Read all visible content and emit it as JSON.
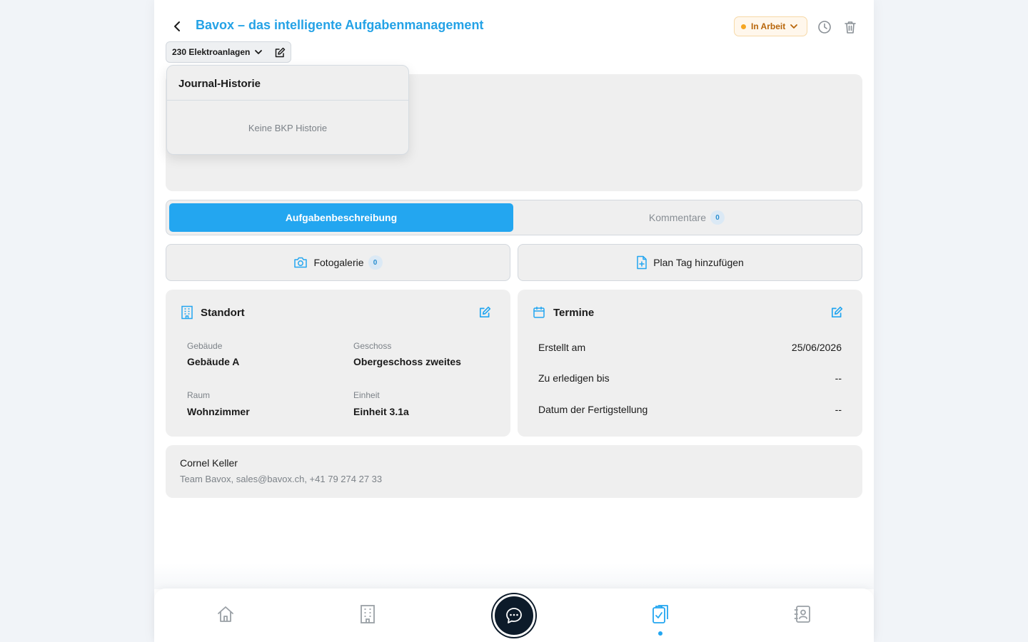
{
  "header": {
    "title": "Bavox – das intelligente Aufgabenmanagement",
    "status": {
      "label": "In Arbeit",
      "dot_color": "#f5a623"
    },
    "bkp": {
      "label": "230 Elektroanlagen"
    }
  },
  "journal_popover": {
    "title": "Journal-Historie",
    "empty_text": "Keine BKP Historie"
  },
  "tabs": [
    {
      "label": "Aufgabenbeschreibung",
      "active": true
    },
    {
      "label": "Kommentare",
      "count": "0",
      "active": false
    }
  ],
  "actions": {
    "gallery": {
      "label": "Fotogalerie",
      "count": "0"
    },
    "plan_tag": {
      "label": "Plan Tag hinzufügen"
    }
  },
  "location": {
    "title": "Standort",
    "fields": [
      {
        "label": "Gebäude",
        "value": "Gebäude A"
      },
      {
        "label": "Geschoss",
        "value": "Obergeschoss zweites"
      },
      {
        "label": "Raum",
        "value": "Wohnzimmer"
      },
      {
        "label": "Einheit",
        "value": "Einheit 3.1a"
      }
    ]
  },
  "dates": {
    "title": "Termine",
    "rows": [
      {
        "label": "Erstellt am",
        "value": "25/06/2026"
      },
      {
        "label": "Zu erledigen bis",
        "value": "--"
      },
      {
        "label": "Datum der Fertigstellung",
        "value": "--"
      }
    ]
  },
  "contact": {
    "name": "Cornel Keller",
    "details": "Team Bavox, sales@bavox.ch, +41 79 274 27 33"
  },
  "bottom_nav": {
    "items": [
      "home-icon",
      "building-icon",
      "chat-icon",
      "tasks-icon",
      "contacts-icon"
    ],
    "active": "tasks-icon"
  },
  "colors": {
    "accent": "#23a6f0",
    "title": "#24a2e6",
    "status_text": "#b8660b",
    "panel": "#efefef"
  }
}
